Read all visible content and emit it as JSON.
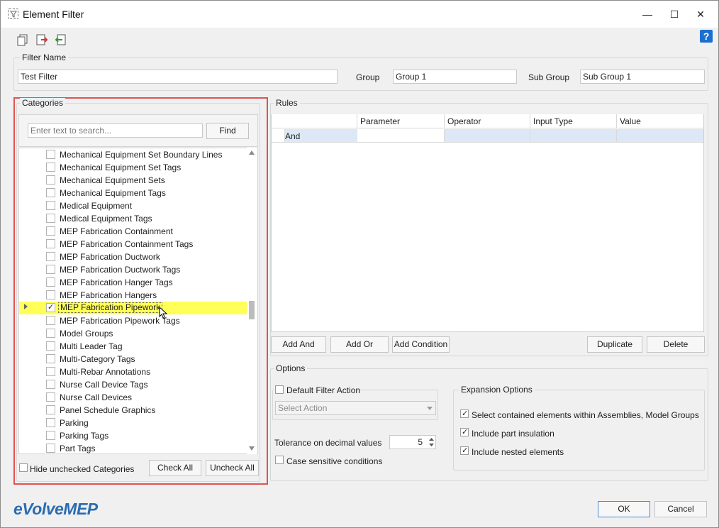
{
  "window": {
    "title": "Element Filter"
  },
  "titlebar_buttons": {
    "minimize": "—",
    "maximize": "☐",
    "close": "✕"
  },
  "toolbar": {
    "help": "?"
  },
  "filter_name": {
    "legend": "Filter Name",
    "value": "Test Filter",
    "group_label": "Group",
    "group_value": "Group 1",
    "sub_group_label": "Sub Group",
    "sub_group_value": "Sub Group 1"
  },
  "categories": {
    "legend": "Categories",
    "search_placeholder": "Enter text to search...",
    "find_label": "Find",
    "items": [
      {
        "label": "Mechanical Equipment Set Boundary Lines",
        "checked": false
      },
      {
        "label": "Mechanical Equipment Set Tags",
        "checked": false
      },
      {
        "label": "Mechanical Equipment Sets",
        "checked": false
      },
      {
        "label": "Mechanical Equipment Tags",
        "checked": false
      },
      {
        "label": "Medical Equipment",
        "checked": false
      },
      {
        "label": "Medical Equipment Tags",
        "checked": false
      },
      {
        "label": "MEP Fabrication Containment",
        "checked": false
      },
      {
        "label": "MEP Fabrication Containment Tags",
        "checked": false
      },
      {
        "label": "MEP Fabrication Ductwork",
        "checked": false
      },
      {
        "label": "MEP Fabrication Ductwork Tags",
        "checked": false
      },
      {
        "label": "MEP Fabrication Hanger Tags",
        "checked": false
      },
      {
        "label": "MEP Fabrication Hangers",
        "checked": false
      },
      {
        "label": "MEP Fabrication Pipework",
        "checked": true,
        "selected": true
      },
      {
        "label": "MEP Fabrication Pipework Tags",
        "checked": false
      },
      {
        "label": "Model Groups",
        "checked": false
      },
      {
        "label": "Multi Leader Tag",
        "checked": false
      },
      {
        "label": "Multi-Category Tags",
        "checked": false
      },
      {
        "label": "Multi-Rebar Annotations",
        "checked": false
      },
      {
        "label": "Nurse Call Device Tags",
        "checked": false
      },
      {
        "label": "Nurse Call Devices",
        "checked": false
      },
      {
        "label": "Panel Schedule Graphics",
        "checked": false
      },
      {
        "label": "Parking",
        "checked": false
      },
      {
        "label": "Parking Tags",
        "checked": false
      },
      {
        "label": "Part Tags",
        "checked": false
      }
    ],
    "hide_unchecked_label": "Hide unchecked Categories",
    "check_all_label": "Check All",
    "uncheck_all_label": "Uncheck All"
  },
  "rules": {
    "legend": "Rules",
    "columns": [
      "Parameter",
      "Operator",
      "Input Type",
      "Value"
    ],
    "rows": [
      {
        "logic": "And",
        "parameter": "",
        "operator": "",
        "input_type": "",
        "value": ""
      }
    ],
    "add_and_label": "Add And",
    "add_or_label": "Add Or",
    "add_condition_label": "Add Condition",
    "duplicate_label": "Duplicate",
    "delete_label": "Delete"
  },
  "options": {
    "legend": "Options",
    "default_filter_action_label": "Default Filter Action",
    "select_action_placeholder": "Select Action",
    "tolerance_label": "Tolerance on decimal values",
    "tolerance_value": "5",
    "case_sensitive_label": "Case sensitive conditions",
    "expansion": {
      "legend": "Expansion Options",
      "items": [
        {
          "label": "Select contained elements within Assemblies, Model Groups",
          "checked": true
        },
        {
          "label": "Include part insulation",
          "checked": true
        },
        {
          "label": "Include nested elements",
          "checked": true
        }
      ]
    }
  },
  "footer": {
    "brand": "eVolveMEP",
    "ok_label": "OK",
    "cancel_label": "Cancel"
  },
  "colors": {
    "highlight": "#ffff57",
    "red_frame": "#e05252",
    "brand": "#2b6cb0",
    "help": "#1a6fd1"
  }
}
